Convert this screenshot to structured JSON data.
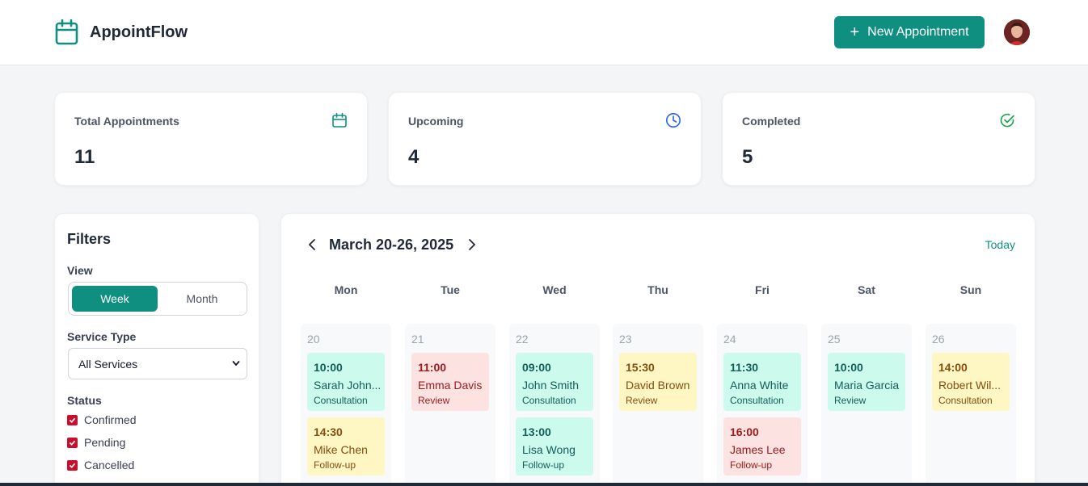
{
  "app": {
    "name": "AppointFlow",
    "new_button": "New Appointment"
  },
  "stats": [
    {
      "label": "Total Appointments",
      "value": "11",
      "icon": "calendar-icon"
    },
    {
      "label": "Upcoming",
      "value": "4",
      "icon": "clock-icon"
    },
    {
      "label": "Completed",
      "value": "5",
      "icon": "check-circle-icon"
    }
  ],
  "filters": {
    "title": "Filters",
    "view_label": "View",
    "view_options": [
      "Week",
      "Month"
    ],
    "view_selected": "Week",
    "service_label": "Service Type",
    "service_selected": "All Services",
    "status_label": "Status",
    "statuses": [
      "Confirmed",
      "Pending",
      "Cancelled"
    ]
  },
  "calendar": {
    "range": "March 20-26, 2025",
    "today": "Today",
    "days": [
      {
        "name": "Mon",
        "date": "20",
        "appts": [
          {
            "time": "10:00",
            "who": "Sarah John...",
            "service": "Consultation",
            "color": "teal"
          },
          {
            "time": "14:30",
            "who": "Mike Chen",
            "service": "Follow-up",
            "color": "yellow"
          }
        ]
      },
      {
        "name": "Tue",
        "date": "21",
        "appts": [
          {
            "time": "11:00",
            "who": "Emma Davis",
            "service": "Review",
            "color": "red"
          }
        ]
      },
      {
        "name": "Wed",
        "date": "22",
        "appts": [
          {
            "time": "09:00",
            "who": "John Smith",
            "service": "Consultation",
            "color": "teal"
          },
          {
            "time": "13:00",
            "who": "Lisa Wong",
            "service": "Follow-up",
            "color": "teal"
          }
        ]
      },
      {
        "name": "Thu",
        "date": "23",
        "appts": [
          {
            "time": "15:30",
            "who": "David Brown",
            "service": "Review",
            "color": "yellow"
          }
        ]
      },
      {
        "name": "Fri",
        "date": "24",
        "appts": [
          {
            "time": "11:30",
            "who": "Anna White",
            "service": "Consultation",
            "color": "teal"
          },
          {
            "time": "16:00",
            "who": "James Lee",
            "service": "Follow-up",
            "color": "red"
          }
        ]
      },
      {
        "name": "Sat",
        "date": "25",
        "appts": [
          {
            "time": "10:00",
            "who": "Maria Garcia",
            "service": "Review",
            "color": "teal"
          }
        ]
      },
      {
        "name": "Sun",
        "date": "26",
        "appts": [
          {
            "time": "14:00",
            "who": "Robert Wil...",
            "service": "Consultation",
            "color": "yellow"
          }
        ]
      }
    ]
  },
  "colors": {
    "accent": "#0f8f80",
    "teal_bg": "#ccfbee",
    "red_bg": "#fde2e2",
    "yellow_bg": "#fef6c3"
  }
}
